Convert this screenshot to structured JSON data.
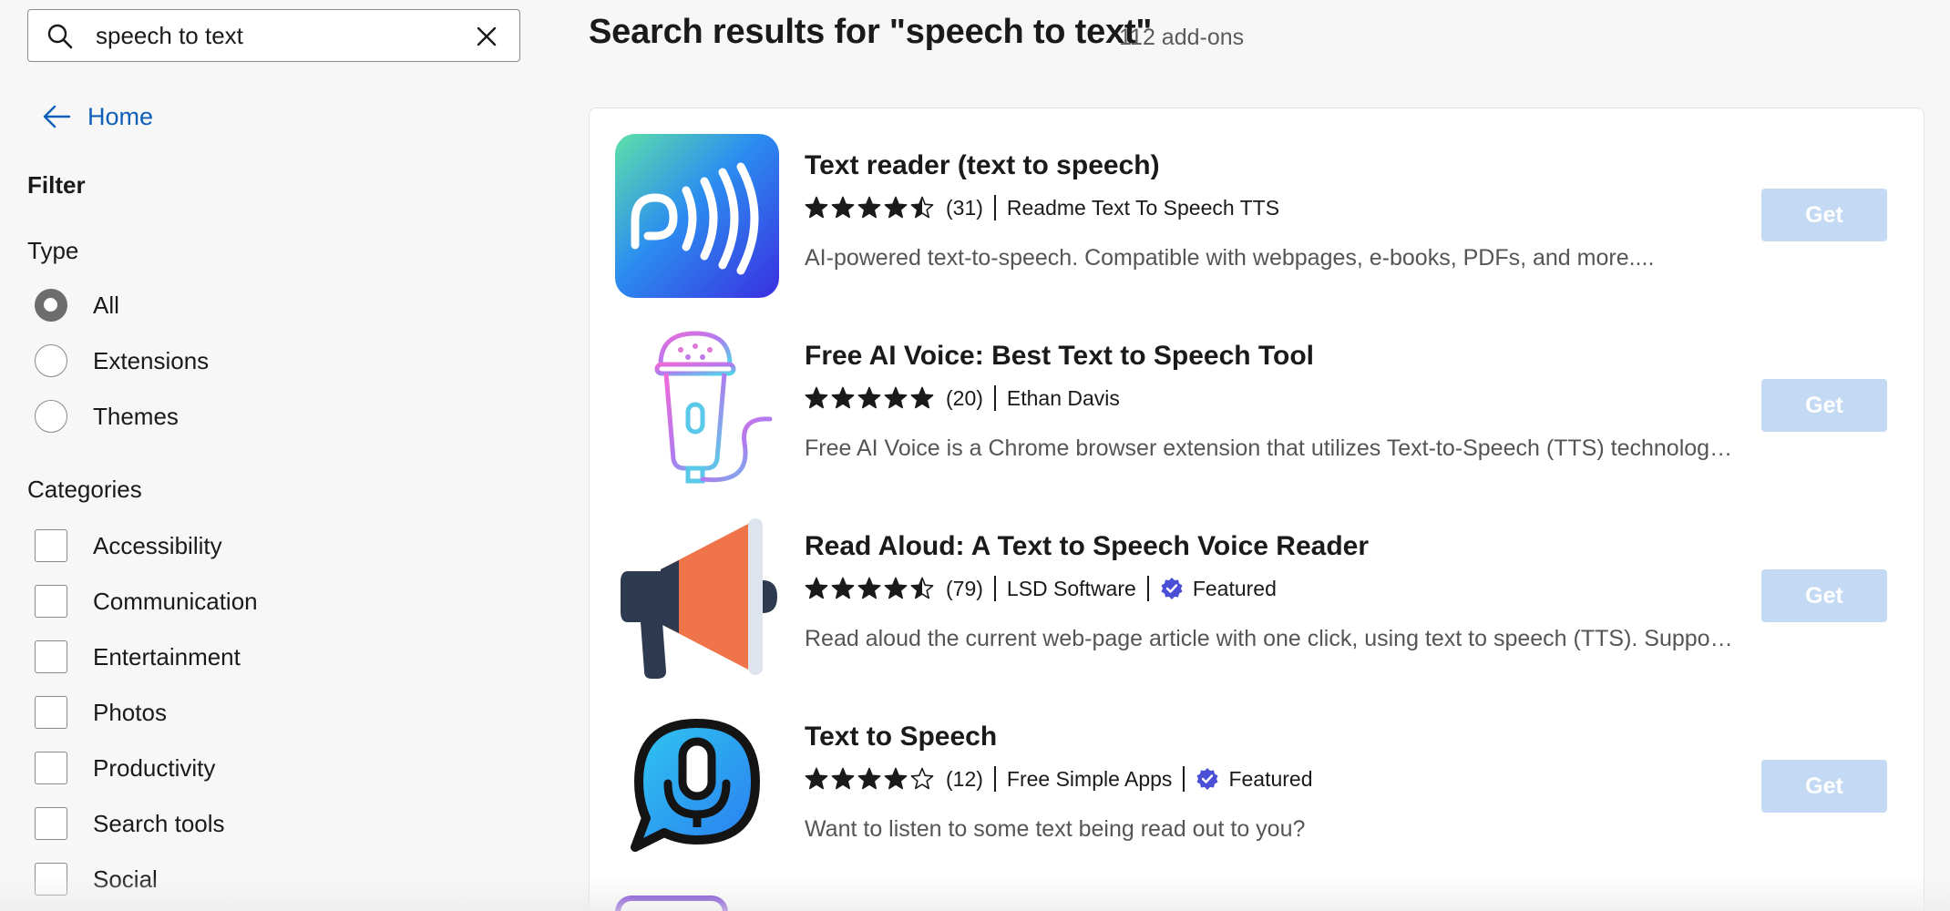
{
  "search": {
    "value": "speech to text",
    "placeholder": ""
  },
  "sidebar": {
    "home_label": "Home",
    "filter_heading": "Filter",
    "type_heading": "Type",
    "type_options": [
      {
        "label": "All",
        "checked": true
      },
      {
        "label": "Extensions",
        "checked": false
      },
      {
        "label": "Themes",
        "checked": false
      }
    ],
    "categories_heading": "Categories",
    "categories": [
      {
        "label": "Accessibility"
      },
      {
        "label": "Communication"
      },
      {
        "label": "Entertainment"
      },
      {
        "label": "Photos"
      },
      {
        "label": "Productivity"
      },
      {
        "label": "Search tools"
      },
      {
        "label": "Social"
      }
    ]
  },
  "main": {
    "results_title": "Search results for \"speech to text\"",
    "results_count": "112 add-ons",
    "get_label": "Get",
    "items": [
      {
        "name": "Text reader (text to speech)",
        "rating": 4.5,
        "reviews": "(31)",
        "publisher": "Readme Text To Speech TTS",
        "featured": false,
        "featured_label": "",
        "description": "AI-powered text-to-speech. Compatible with webpages, e-books, PDFs, and more....",
        "icon": "sound-wave-icon"
      },
      {
        "name": "Free AI Voice: Best Text to Speech Tool",
        "rating": 5,
        "reviews": "(20)",
        "publisher": "Ethan Davis",
        "featured": false,
        "featured_label": "",
        "description": "Free AI Voice is a Chrome browser extension that utilizes Text-to-Speech (TTS) technology...",
        "icon": "microphone-icon"
      },
      {
        "name": "Read Aloud: A Text to Speech Voice Reader",
        "rating": 4.5,
        "reviews": "(79)",
        "publisher": "LSD Software",
        "featured": true,
        "featured_label": "Featured",
        "description": "Read aloud the current web-page article with one click, using text to speech (TTS). Suppor...",
        "icon": "megaphone-icon"
      },
      {
        "name": "Text to Speech",
        "rating": 4,
        "reviews": "(12)",
        "publisher": "Free Simple Apps",
        "featured": true,
        "featured_label": "Featured",
        "description": "Want to listen to some text being read out to you?",
        "icon": "speech-bubble-mic-icon"
      }
    ]
  },
  "colors": {
    "link": "#0f5fb8",
    "get_button": "#c4d9f3",
    "featured_badge": "#4a4fd6"
  }
}
